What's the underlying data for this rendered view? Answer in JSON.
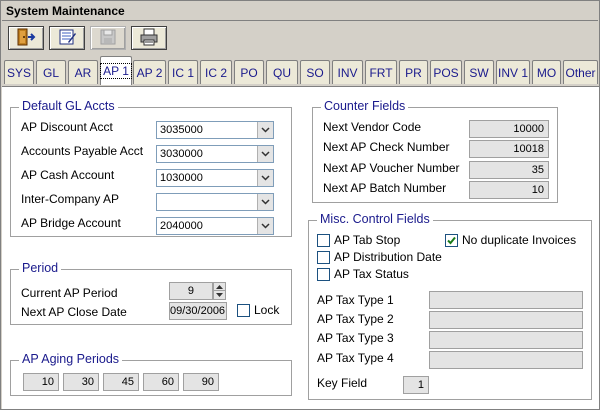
{
  "window": {
    "title": "System Maintenance"
  },
  "toolbar": {
    "buttons": [
      {
        "icon": "exit-door-icon"
      },
      {
        "icon": "notebook-edit-icon"
      },
      {
        "icon": "save-disk-icon"
      },
      {
        "icon": "print-icon"
      }
    ]
  },
  "tabs": [
    "SYS",
    "GL",
    "AR",
    "AP 1",
    "AP 2",
    "IC 1",
    "IC 2",
    "PO",
    "QU",
    "SO",
    "INV",
    "FRT",
    "PR",
    "POS",
    "SW",
    "INV 1",
    "MO",
    "Other"
  ],
  "active_tab": "AP 1",
  "default_gl": {
    "title": "Default  GL Accts",
    "rows": [
      {
        "label": "AP Discount Acct",
        "value": "3035000"
      },
      {
        "label": "Accounts Payable Acct",
        "value": "3030000"
      },
      {
        "label": "AP Cash Account",
        "value": "1030000"
      },
      {
        "label": "Inter-Company AP",
        "value": ""
      },
      {
        "label": "AP Bridge Account",
        "value": "2040000"
      }
    ]
  },
  "period": {
    "title": "Period",
    "current_label": "Current AP Period",
    "current_value": "9",
    "next_label": "Next AP Close Date",
    "next_value": "09/30/2006",
    "lock_label": "Lock",
    "lock_checked": false
  },
  "aging": {
    "title": "AP Aging Periods",
    "values": [
      "10",
      "30",
      "45",
      "60",
      "90"
    ]
  },
  "counter": {
    "title": "Counter Fields",
    "rows": [
      {
        "label": "Next Vendor Code",
        "value": "10000"
      },
      {
        "label": "Next AP Check Number",
        "value": "10018"
      },
      {
        "label": "Next AP Voucher Number",
        "value": "35"
      },
      {
        "label": "Next AP Batch Number",
        "value": "10"
      }
    ]
  },
  "misc": {
    "title": "Misc. Control Fields",
    "tab_stop_label": "AP Tab Stop",
    "tab_stop_checked": false,
    "no_dup_label": "No duplicate Invoices",
    "no_dup_checked": true,
    "dist_date_label": "AP Distribution Date",
    "dist_date_checked": false,
    "tax_status_label": "AP Tax Status",
    "tax_status_checked": false,
    "tax_types": [
      {
        "label": "AP Tax Type 1",
        "value": ""
      },
      {
        "label": "AP Tax Type 2",
        "value": ""
      },
      {
        "label": "AP Tax Type 3",
        "value": ""
      },
      {
        "label": "AP Tax Type 4",
        "value": ""
      }
    ],
    "key_field_label": "Key Field",
    "key_field_value": "1"
  },
  "colors": {
    "accent": "#1a1a8c",
    "chrome": "#d4d0c8"
  }
}
